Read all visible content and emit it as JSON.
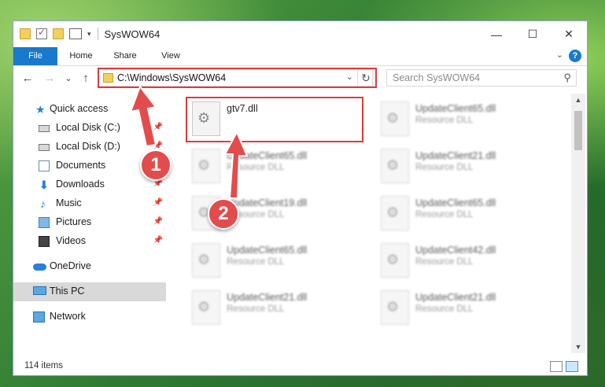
{
  "window": {
    "title": "SysWOW64",
    "minimize_glyph": "—",
    "maximize_glyph": "☐",
    "close_glyph": "✕"
  },
  "ribbon": {
    "tabs": [
      {
        "label": "File"
      },
      {
        "label": "Home"
      },
      {
        "label": "Share"
      },
      {
        "label": "View"
      }
    ],
    "help_label": "?",
    "expand_glyph": "⌄"
  },
  "nav": {
    "back_glyph": "←",
    "forward_glyph": "→",
    "recent_glyph": "⌄",
    "up_glyph": "↑",
    "address": "C:\\Windows\\SysWOW64",
    "address_dropdown_glyph": "⌄",
    "refresh_glyph": "↻",
    "search_placeholder": "Search SysWOW64",
    "search_glyph": "⚲"
  },
  "sidebar": {
    "items": [
      {
        "label": "Quick access",
        "icon": "star-icon",
        "pinned": false
      },
      {
        "label": "Local Disk (C:)",
        "icon": "disk-icon",
        "pinned": true
      },
      {
        "label": "Local Disk (D:)",
        "icon": "disk-icon",
        "pinned": true
      },
      {
        "label": "Documents",
        "icon": "documents-icon",
        "pinned": true
      },
      {
        "label": "Downloads",
        "icon": "download-icon",
        "pinned": true
      },
      {
        "label": "Music",
        "icon": "music-icon",
        "pinned": true
      },
      {
        "label": "Pictures",
        "icon": "pictures-icon",
        "pinned": true
      },
      {
        "label": "Videos",
        "icon": "videos-icon",
        "pinned": true
      },
      {
        "label": "OneDrive",
        "icon": "cloud-icon",
        "pinned": false
      },
      {
        "label": "This PC",
        "icon": "computer-icon",
        "pinned": false,
        "selected": true
      },
      {
        "label": "Network",
        "icon": "network-icon",
        "pinned": false
      }
    ],
    "pin_glyph": "📌"
  },
  "files": [
    {
      "name": "gtv7.dll",
      "type": "",
      "highlighted": true
    },
    {
      "name": "UpdateClient65.dll",
      "type": "Resource DLL"
    },
    {
      "name": "UpdateClient65.dll",
      "type": "Resource DLL"
    },
    {
      "name": "UpdateClient21.dll",
      "type": "Resource DLL"
    },
    {
      "name": "UpdateClient19.dll",
      "type": "Resource DLL"
    },
    {
      "name": "UpdateClient65.dll",
      "type": "Resource DLL"
    },
    {
      "name": "UpdateClient65.dll",
      "type": "Resource DLL"
    },
    {
      "name": "UpdateClient42.dll",
      "type": "Resource DLL"
    },
    {
      "name": "UpdateClient21.dll",
      "type": "Resource DLL"
    },
    {
      "name": "UpdateClient21.dll",
      "type": "Resource DLL"
    }
  ],
  "status": {
    "item_count": "114 items"
  },
  "callouts": [
    "1",
    "2"
  ],
  "colors": {
    "accent": "#1979ca",
    "highlight_red": "#dd3b3b",
    "callout_red": "#e24c4c"
  }
}
